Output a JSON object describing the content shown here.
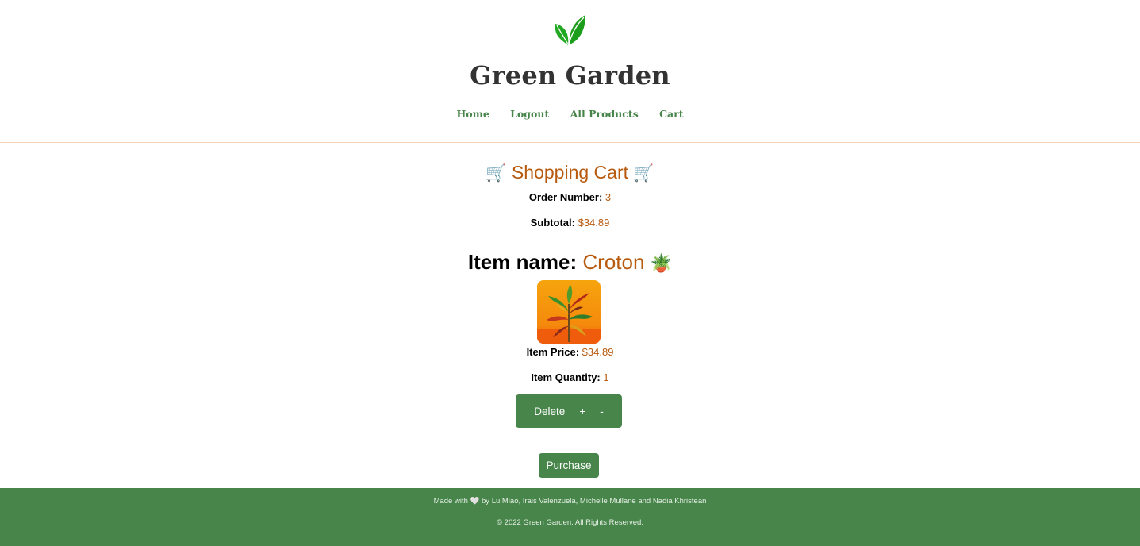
{
  "header": {
    "brand": "Green Garden",
    "logo_icon": "leaf-icon",
    "nav": [
      {
        "label": "Home"
      },
      {
        "label": "Logout"
      },
      {
        "label": "All Products"
      },
      {
        "label": "Cart"
      }
    ]
  },
  "cart": {
    "title_icon": "🛒",
    "title": "Shopping Cart",
    "order_label": "Order Number:",
    "order_number": "3",
    "subtotal_label": "Subtotal:",
    "subtotal": "$34.89"
  },
  "item": {
    "name_label": "Item name:",
    "name": "Croton",
    "name_icon": "🪴",
    "image_icon": "croton-plant-image",
    "price_label": "Item Price:",
    "price": "$34.89",
    "quantity_label": "Item Quantity:",
    "quantity": "1",
    "actions": {
      "delete": "Delete",
      "plus": "+",
      "minus": "-"
    }
  },
  "purchase_label": "Purchase",
  "footer": {
    "made_prefix": "Made with",
    "heart_icon": "🤍",
    "made_suffix": "by Lu Miao, Irais Valenzuela, Michelle Mullane and Nadia Khristean",
    "copyright": "© 2022 Green Garden. All Rights Reserved."
  },
  "colors": {
    "brand_green": "#47854a",
    "accent_orange": "#b85a0e",
    "leaf_green": "#1fa31f"
  }
}
